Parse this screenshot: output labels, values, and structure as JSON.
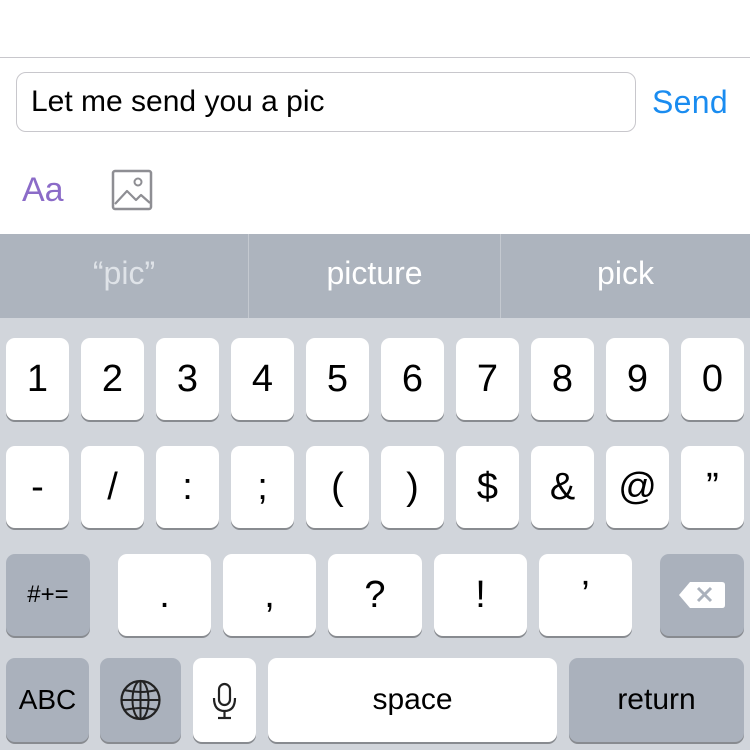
{
  "compose": {
    "message_text": "Let me send you a pic",
    "send_label": "Send",
    "format_label": "Aa",
    "image_icon": "image-icon",
    "colors": {
      "send": "#1a8cf0",
      "format": "#8b6bc8"
    }
  },
  "keyboard": {
    "suggestions": [
      "“pic”",
      "picture",
      "pick"
    ],
    "row1": [
      "1",
      "2",
      "3",
      "4",
      "5",
      "6",
      "7",
      "8",
      "9",
      "0"
    ],
    "row2": [
      "-",
      "/",
      ":",
      ";",
      "(",
      ")",
      "$",
      "&",
      "@",
      "”"
    ],
    "row3": [
      ".",
      ",",
      "?",
      "!",
      "’"
    ],
    "symbols_toggle_label": "#+=",
    "backspace_icon": "backspace-icon",
    "abc_label": "ABC",
    "globe_icon": "globe-icon",
    "mic_icon": "microphone-icon",
    "space_label": "space",
    "return_label": "return"
  }
}
